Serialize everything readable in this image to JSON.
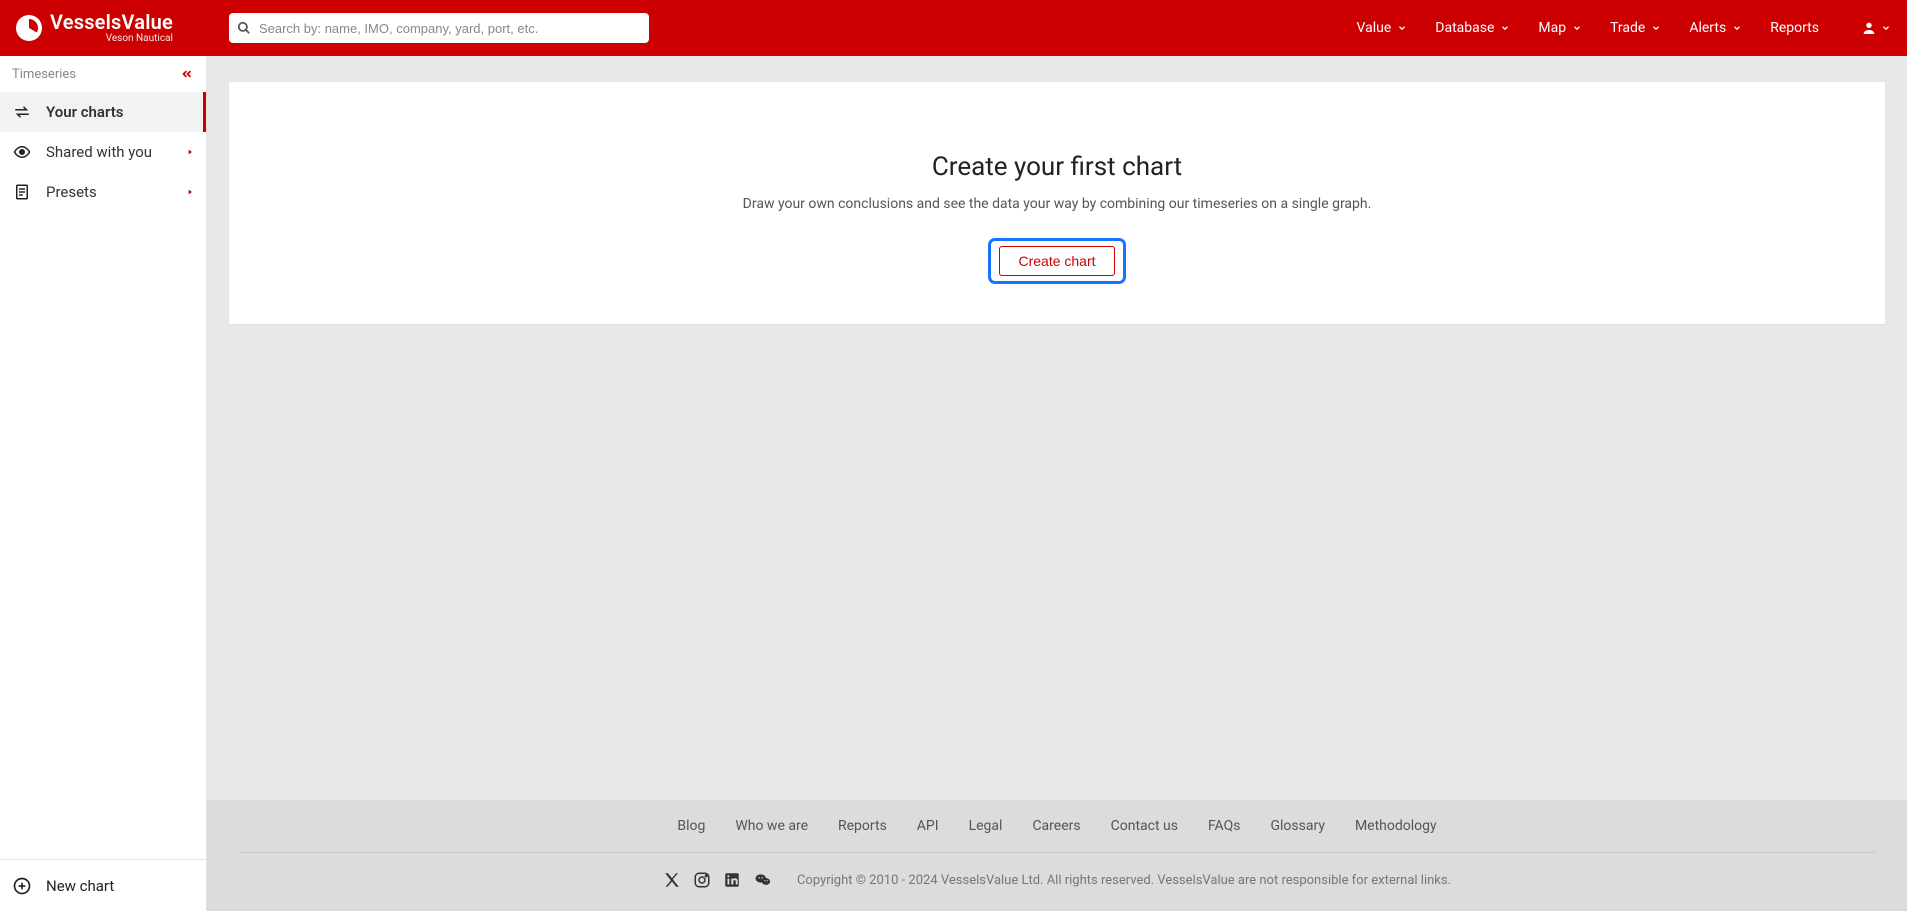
{
  "brand": {
    "name": "VesselsValue",
    "sub": "Veson Nautical"
  },
  "search": {
    "placeholder": "Search by: name, IMO, company, yard, port, etc."
  },
  "nav": {
    "value": "Value",
    "database": "Database",
    "map": "Map",
    "trade": "Trade",
    "alerts": "Alerts",
    "reports": "Reports"
  },
  "sidebar": {
    "section_title": "Timeseries",
    "items": {
      "your_charts": "Your charts",
      "shared": "Shared with you",
      "presets": "Presets"
    },
    "new_chart": "New chart"
  },
  "empty_state": {
    "title": "Create your first chart",
    "subtitle": "Draw your own conclusions and see the data your way by combining our timeseries on a single graph.",
    "button": "Create chart"
  },
  "footer": {
    "links": {
      "blog": "Blog",
      "who": "Who we are",
      "reports": "Reports",
      "api": "API",
      "legal": "Legal",
      "careers": "Careers",
      "contact": "Contact us",
      "faqs": "FAQs",
      "glossary": "Glossary",
      "methodology": "Methodology"
    },
    "copyright": "Copyright © 2010 - 2024 VesselsValue Ltd. All rights reserved. VesselsValue are not responsible for external links."
  }
}
